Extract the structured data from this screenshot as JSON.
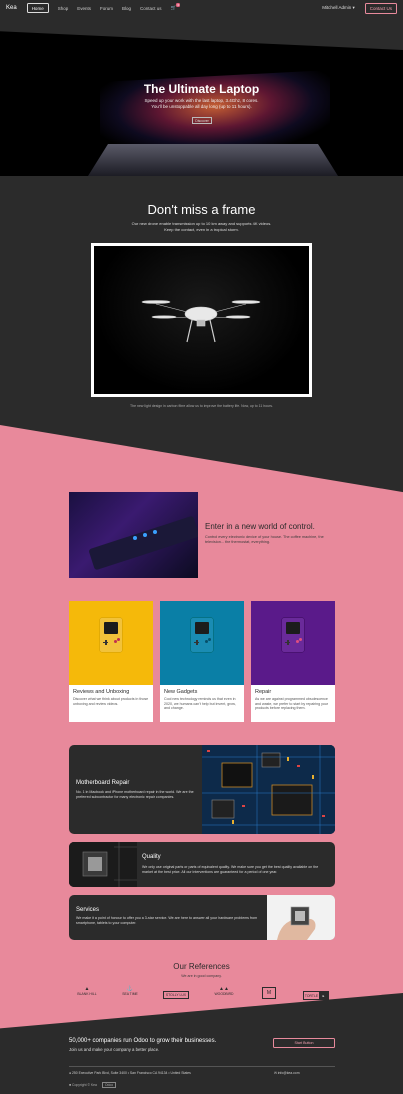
{
  "nav": {
    "brand": "Kea",
    "items": [
      "Home",
      "Shop",
      "Events",
      "Forum",
      "Blog",
      "Contact us"
    ],
    "cart_count": "0",
    "user": "Mitchell Admin",
    "contact_btn": "Contact Us"
  },
  "hero": {
    "title": "The Ultimate Laptop",
    "sub1": "Speed up your work with the last laptop, 3.4Ghz, 8 cores.",
    "sub2": "You'll be unstoppable all day long (up to 11 hours).",
    "button": "Discover"
  },
  "frame": {
    "title": "Don't miss a frame",
    "sub1": "Our new drone enable transmission up to 10 km away and supports 4K videos.",
    "sub2": "Keep the contact, even in a tropical storm.",
    "caption": "The new light design in carbon fibre allow us to improve the battery life. Now, up to 11 hours."
  },
  "control": {
    "title": "Enter in a new world of control.",
    "text": "Control every electronic device of your house. The coffee machine, the television... the thermostat, everything."
  },
  "cards": [
    {
      "title": "Reviews and Unboxing",
      "text": "Discover what we think about products in those unboxing and review videos.",
      "color": "#f5b90a"
    },
    {
      "title": "New Gadgets",
      "text": "Cool new technology reminds us that even in 2020, we humans can't help but invent, grow, and change.",
      "color": "#0a7fa6"
    },
    {
      "title": "Repair",
      "text": "As we are against programmed obsolescence and waste, we prefer to start by repairing your products before replacing them.",
      "color": "#5a1a8a"
    }
  ],
  "blocks": {
    "motherboard": {
      "title": "Motherboard Repair",
      "text": "No. 1 in Macbook and iPhone motherboard repair in the world. We are the preferred subcontractor for many electronic repair companies."
    },
    "quality": {
      "title": "Quality",
      "text": "We only use original parts or parts of equivalent quality. We make sure you get the best quality available on the market at the best price. All our interventions are guaranteed for a period of one year."
    },
    "services": {
      "title": "Services",
      "text": "We make it a point of honour to offer you a 3-star service. We are here to answer all your hardware problems from smartphone, tablets to your computer."
    }
  },
  "refs": {
    "title": "Our References",
    "sub": "We are in good company.",
    "logos": [
      "BLANK HILL",
      "SEA TIME",
      "STOLLY LUX",
      "WOODBIRD",
      "M",
      "TORTLE"
    ]
  },
  "cta": {
    "title": "50,000+ companies run Odoo to grow their businesses.",
    "sub": "Join us and make your company a better place.",
    "button": "Start Button"
  },
  "footer": {
    "address": "250 Executive Park Blvd, Suite 3400 • San Francisco CA 94134 • United States",
    "email": "info@kea.com",
    "copyright": "Copyright © Kea",
    "powered": "Odoo"
  }
}
